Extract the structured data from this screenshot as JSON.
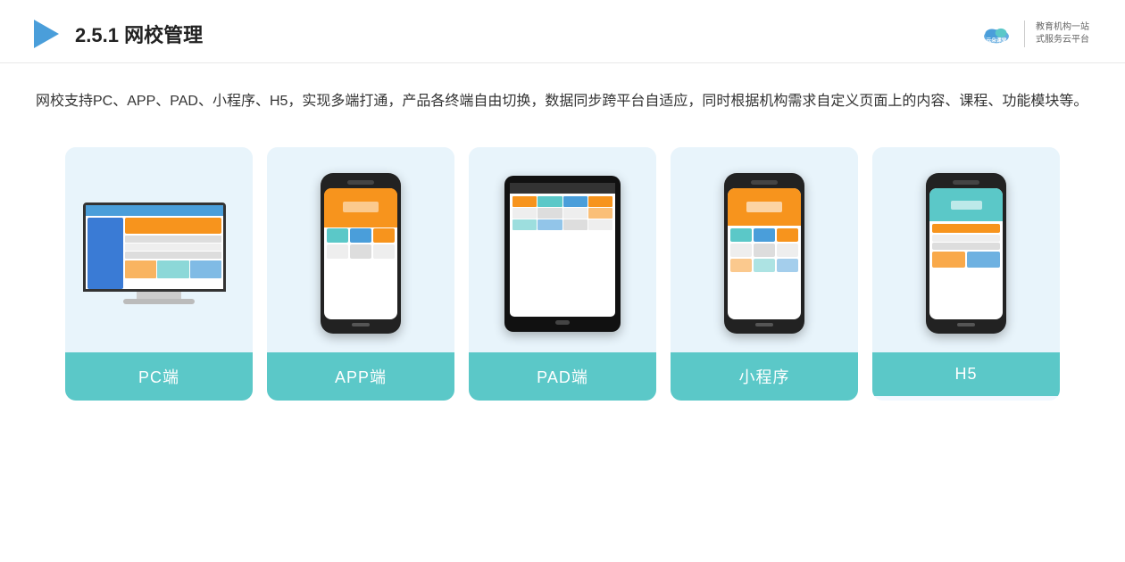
{
  "header": {
    "section_number": "2.5.1",
    "title": "网校管理",
    "logo": {
      "site": "yunduoketang.com",
      "tagline_line1": "教育机构一站",
      "tagline_line2": "式服务云平台"
    }
  },
  "description": {
    "text": "网校支持PC、APP、PAD、小程序、H5，实现多端打通，产品各终端自由切换，数据同步跨平台自适应，同时根据机构需求自定义页面上的内容、课程、功能模块等。"
  },
  "cards": [
    {
      "id": "pc",
      "label": "PC端",
      "type": "pc"
    },
    {
      "id": "app",
      "label": "APP端",
      "type": "phone"
    },
    {
      "id": "pad",
      "label": "PAD端",
      "type": "tablet"
    },
    {
      "id": "miniprogram",
      "label": "小程序",
      "type": "phone"
    },
    {
      "id": "h5",
      "label": "H5",
      "type": "phone"
    }
  ],
  "colors": {
    "teal": "#5bc8c8",
    "blue": "#4a9eda",
    "orange": "#f7941d",
    "dark": "#222",
    "text": "#333"
  }
}
